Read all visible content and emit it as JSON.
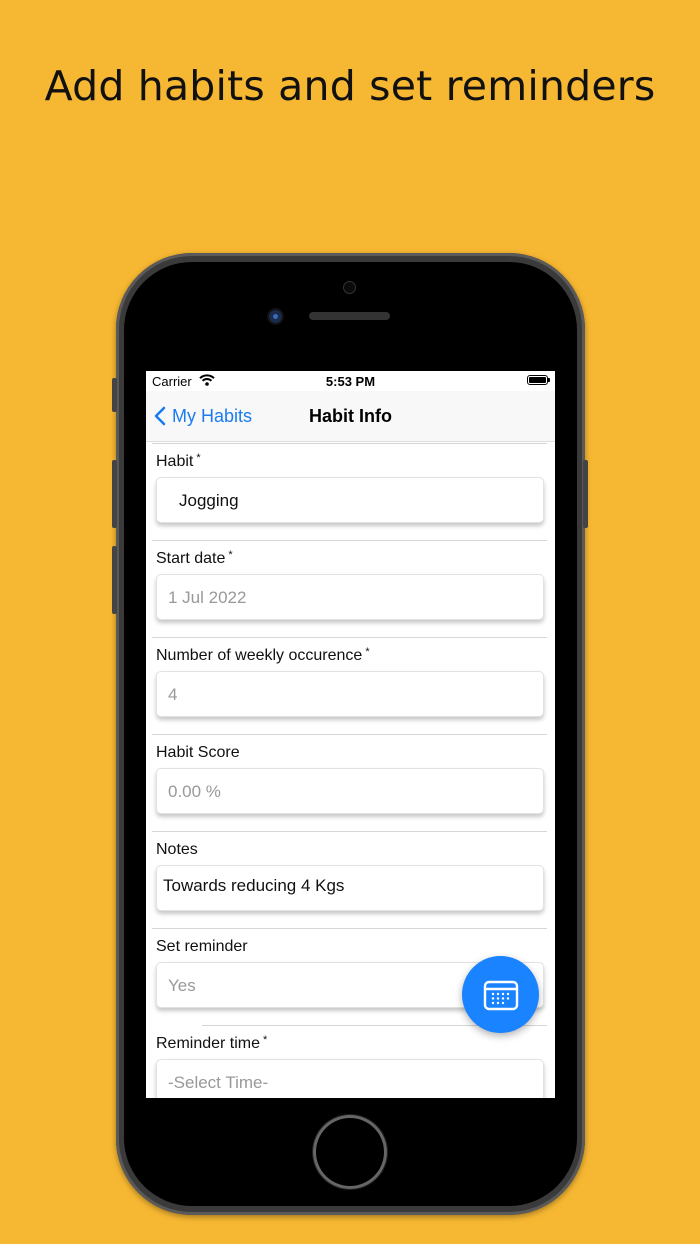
{
  "headline": "Add habits and set reminders",
  "status_bar": {
    "carrier": "Carrier",
    "time": "5:53 PM"
  },
  "nav": {
    "back_label": "My Habits",
    "title": "Habit Info"
  },
  "fields": [
    {
      "label": "Habit",
      "required": "*",
      "value": "Jogging",
      "filled": true
    },
    {
      "label": "Start date",
      "required": "*",
      "value": "1 Jul 2022",
      "filled": false
    },
    {
      "label": "Number of weekly occurence",
      "required": "*",
      "value": "4",
      "filled": false
    },
    {
      "label": "Habit Score",
      "required": "",
      "value": "0.00 %",
      "filled": false
    },
    {
      "label": "Notes",
      "required": "",
      "value": "Towards reducing 4 Kgs",
      "filled": true
    },
    {
      "label": "Set reminder",
      "required": "",
      "value": "Yes",
      "filled": false
    },
    {
      "label": "Reminder time",
      "required": "*",
      "value": "-Select Time-",
      "filled": false
    }
  ],
  "colors": {
    "background": "#F6B732",
    "accent": "#1a7cf0",
    "fab": "#1a83ff"
  },
  "icons": {
    "back": "chevron-left-icon",
    "fab": "calendar-icon",
    "wifi": "wifi-icon",
    "battery": "battery-icon"
  }
}
